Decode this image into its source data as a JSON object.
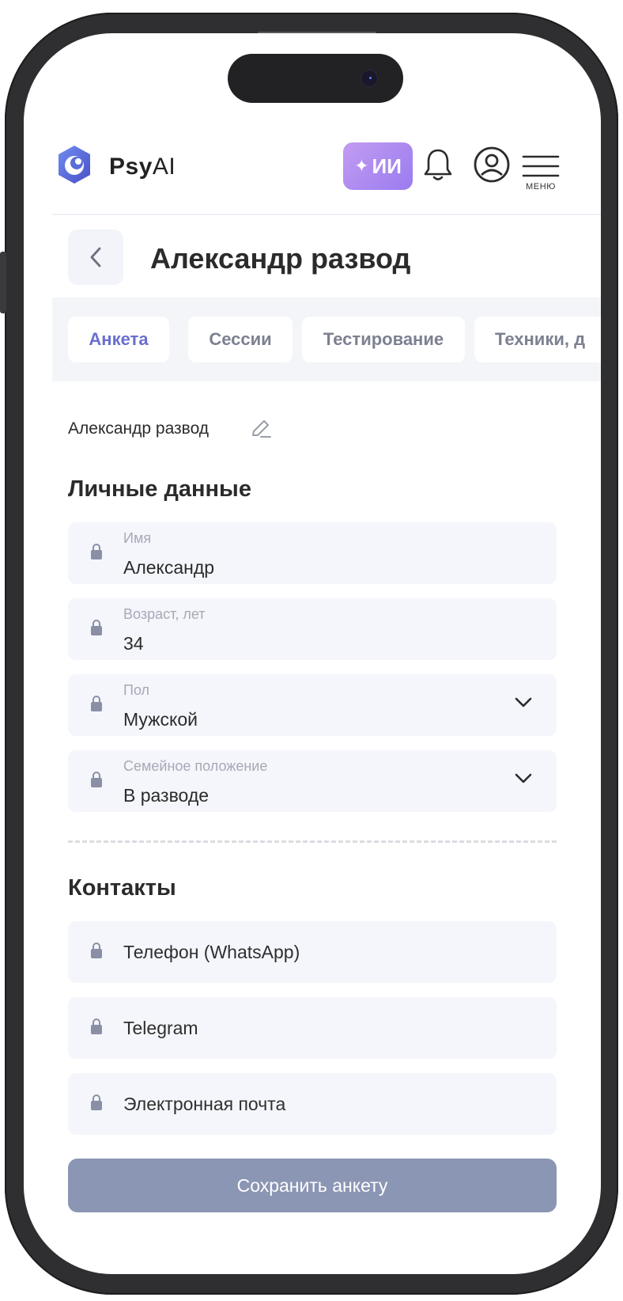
{
  "header": {
    "brand_psy": "Psy",
    "brand_ai": "AI",
    "ai_button_label": "ИИ",
    "menu_label": "МЕНЮ"
  },
  "page": {
    "title": "Александр развод"
  },
  "tabs": [
    {
      "label": "Анкета",
      "active": true
    },
    {
      "label": "Сессии",
      "active": false
    },
    {
      "label": "Тестирование",
      "active": false
    },
    {
      "label": "Техники, д",
      "active": false
    }
  ],
  "case_name": "Александр развод",
  "personal": {
    "title": "Личные данные",
    "fields": [
      {
        "label": "Имя",
        "value": "Александр"
      },
      {
        "label": "Возраст, лет",
        "value": "34"
      },
      {
        "label": "Пол",
        "value": "Мужской"
      },
      {
        "label": "Семейное положение",
        "value": "В разводе"
      }
    ]
  },
  "contacts": {
    "title": "Контакты",
    "fields": [
      {
        "placeholder": "Телефон (WhatsApp)"
      },
      {
        "placeholder": "Telegram"
      },
      {
        "placeholder": "Электронная почта"
      }
    ]
  },
  "save_button_label": "Сохранить анкету",
  "colors": {
    "accent": "#6a6ed0",
    "ai_gradient_start": "#c29bf1",
    "ai_gradient_end": "#9a7cf0",
    "field_bg": "#f4f6fb",
    "save_bg": "#8b96b4"
  },
  "icons": [
    "logo-icon",
    "sparkle-icon",
    "bell-icon",
    "profile-icon",
    "menu-icon",
    "back-arrow-icon",
    "edit-icon",
    "lock-icon",
    "chevron-down-icon"
  ]
}
